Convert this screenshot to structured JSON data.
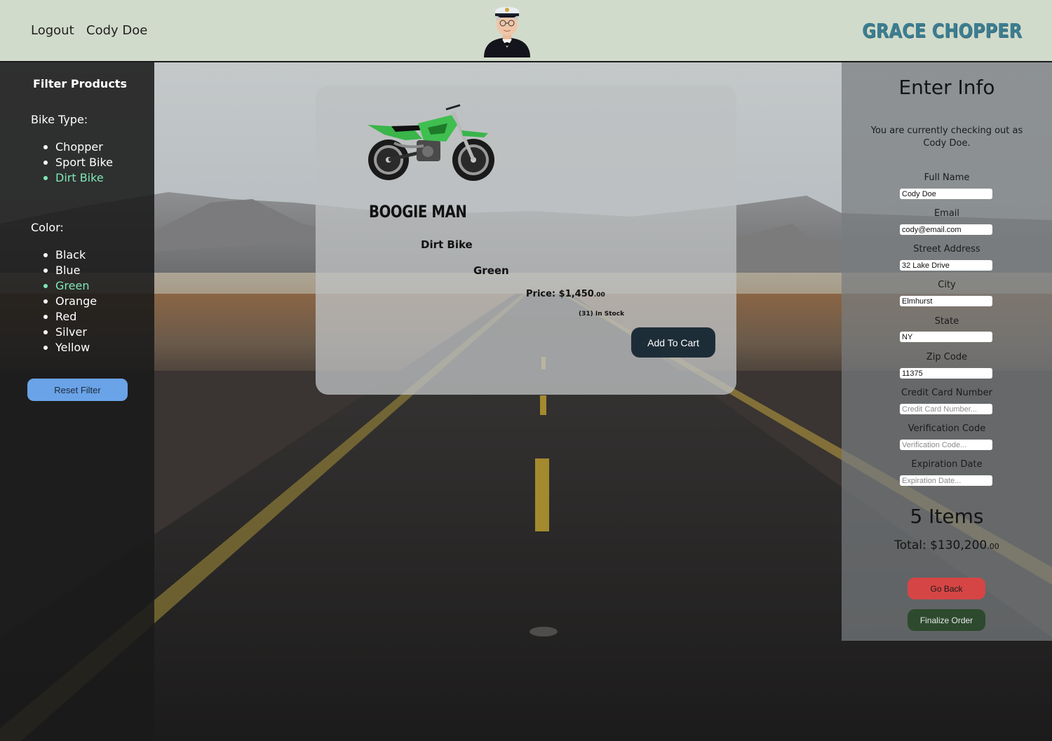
{
  "header": {
    "logout_label": "Logout",
    "user_name": "Cody Doe",
    "brand": "GRACE CHOPPER",
    "brand_color": "#3d7d90",
    "avatar_icon": "captain-avatar-icon"
  },
  "sidebar": {
    "title": "Filter Products",
    "bike_type_label": "Bike Type:",
    "bike_types": [
      {
        "label": "Chopper",
        "active": false
      },
      {
        "label": "Sport Bike",
        "active": false
      },
      {
        "label": "Dirt Bike",
        "active": true
      }
    ],
    "color_label": "Color:",
    "colors": [
      {
        "label": "Black",
        "active": false
      },
      {
        "label": "Blue",
        "active": false
      },
      {
        "label": "Green",
        "active": true
      },
      {
        "label": "Orange",
        "active": false
      },
      {
        "label": "Red",
        "active": false
      },
      {
        "label": "Silver",
        "active": false
      },
      {
        "label": "Yellow",
        "active": false
      }
    ],
    "active_color": "#7ee8b7",
    "reset_label": "Reset Filter"
  },
  "product": {
    "name": "BOOGIE MAN",
    "type": "Dirt Bike",
    "color": "Green",
    "price_prefix": "Price: ",
    "price_main": "$1,450",
    "price_cents": ".00",
    "stock": "(31) In Stock",
    "add_to_cart_label": "Add To Cart",
    "image_icon": "green-dirt-bike-image"
  },
  "checkout": {
    "title": "Enter Info",
    "note": "You are currently checking out as Cody Doe.",
    "fields": {
      "full_name": {
        "label": "Full Name",
        "value": "Cody Doe",
        "placeholder": ""
      },
      "email": {
        "label": "Email",
        "value": "cody@email.com",
        "placeholder": ""
      },
      "street": {
        "label": "Street Address",
        "value": "32 Lake Drive",
        "placeholder": ""
      },
      "city": {
        "label": "City",
        "value": "Elmhurst",
        "placeholder": ""
      },
      "state": {
        "label": "State",
        "value": "NY",
        "placeholder": ""
      },
      "zip": {
        "label": "Zip Code",
        "value": "11375",
        "placeholder": ""
      },
      "card_number": {
        "label": "Credit Card Number",
        "value": "",
        "placeholder": "Credit Card Number..."
      },
      "cvv": {
        "label": "Verification Code",
        "value": "",
        "placeholder": "Verification Code..."
      },
      "expiration": {
        "label": "Expiration Date",
        "value": "",
        "placeholder": "Expiration Date..."
      }
    },
    "items_count": "5 Items",
    "total_prefix": "Total: ",
    "total_main": "$130,200",
    "total_cents": ".00",
    "go_back_label": "Go Back",
    "finalize_label": "Finalize Order",
    "go_back_color": "#d64545",
    "finalize_color": "#2d4a2e"
  }
}
